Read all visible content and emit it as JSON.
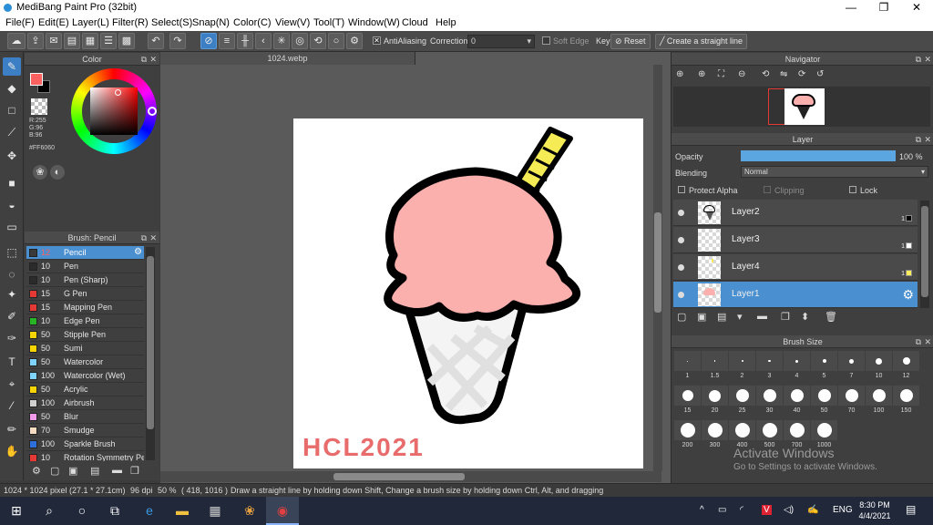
{
  "window": {
    "title": "MediBang Paint Pro (32bit)",
    "min": "—",
    "max": "❐",
    "close": "✕"
  },
  "menu": [
    "File(F)",
    "Edit(E)",
    "Layer(L)",
    "Filter(R)",
    "Select(S)",
    "Snap(N)",
    "Color(C)",
    "View(V)",
    "Tool(T)",
    "Window(W)",
    "Cloud",
    "Help"
  ],
  "toolbar": {
    "antialiasing_label": "AntiAliasing",
    "correction_label": "Correction",
    "correction_value": "0",
    "soft_edge_label": "Soft Edge",
    "key_label": "Key",
    "reset_label": "Reset",
    "straight_line_label": "Create a straight line"
  },
  "color_panel": {
    "title": "Color",
    "r": "R:255",
    "g": "G:96",
    "b": "B:96",
    "hex": "#FF6060",
    "main_color": "#ff6060"
  },
  "brush_panel": {
    "title": "Brush: Pencil",
    "items": [
      {
        "size": "12",
        "name": "Pencil",
        "color": "#3a3a3a",
        "selected": true
      },
      {
        "size": "10",
        "name": "Pen",
        "color": "#2b2b2b"
      },
      {
        "size": "10",
        "name": "Pen (Sharp)",
        "color": "#2b2b2b"
      },
      {
        "size": "15",
        "name": "G Pen",
        "color": "#e53935"
      },
      {
        "size": "15",
        "name": "Mapping Pen",
        "color": "#e53935"
      },
      {
        "size": "10",
        "name": "Edge Pen",
        "color": "#27b427"
      },
      {
        "size": "50",
        "name": "Stipple Pen",
        "color": "#f5d400"
      },
      {
        "size": "50",
        "name": "Sumi",
        "color": "#f5d400"
      },
      {
        "size": "50",
        "name": "Watercolor",
        "color": "#7fd4ff"
      },
      {
        "size": "100",
        "name": "Watercolor (Wet)",
        "color": "#7fd4ff"
      },
      {
        "size": "50",
        "name": "Acrylic",
        "color": "#f5d400"
      },
      {
        "size": "100",
        "name": "Airbrush",
        "color": "#d0d0d0"
      },
      {
        "size": "50",
        "name": "Blur",
        "color": "#f19ae8"
      },
      {
        "size": "70",
        "name": "Smudge",
        "color": "#f6dcc0"
      },
      {
        "size": "100",
        "name": "Sparkle Brush",
        "color": "#2e6fdc"
      },
      {
        "size": "10",
        "name": "Rotation Symmetry Pe",
        "color": "#e53935"
      }
    ]
  },
  "canvas": {
    "tab": "1024.webp",
    "signature": "HCL2021"
  },
  "navigator": {
    "title": "Navigator"
  },
  "layer_panel": {
    "title": "Layer",
    "opacity_label": "Opacity",
    "opacity_value": "100 %",
    "opacity_fraction": 1.0,
    "blending_label": "Blending",
    "blending_value": "Normal",
    "protect_alpha": "Protect Alpha",
    "clipping": "Clipping",
    "lock": "Lock",
    "layers": [
      {
        "name": "Layer2",
        "num": "1",
        "color": "#000000",
        "selected": false
      },
      {
        "name": "Layer3",
        "num": "1",
        "color": "#ffffff",
        "selected": false
      },
      {
        "name": "Layer4",
        "num": "1",
        "color": "#ffef5a",
        "selected": false
      },
      {
        "name": "Layer1",
        "num": "",
        "color": "",
        "selected": true
      }
    ]
  },
  "brush_size": {
    "title": "Brush Size",
    "sizes": [
      "1",
      "1.5",
      "2",
      "3",
      "4",
      "5",
      "7",
      "10",
      "12",
      "15",
      "20",
      "25",
      "30",
      "40",
      "50",
      "70",
      "100",
      "150",
      "200",
      "300",
      "400",
      "500",
      "700",
      "1000"
    ]
  },
  "watermark": {
    "line1": "Activate Windows",
    "line2": "Go to Settings to activate Windows."
  },
  "status": {
    "size": "1024 * 1024 pixel",
    "dims": "(27.1 * 27.1cm)",
    "dpi": "96 dpi",
    "zoom": "50 %",
    "coords": "( 418, 1016 )",
    "hint": "Draw a straight line by holding down Shift, Change a brush size by holding down Ctrl, Alt, and dragging"
  },
  "taskbar": {
    "lang": "ENG",
    "time": "8:30 PM",
    "date": "4/4/2021"
  }
}
